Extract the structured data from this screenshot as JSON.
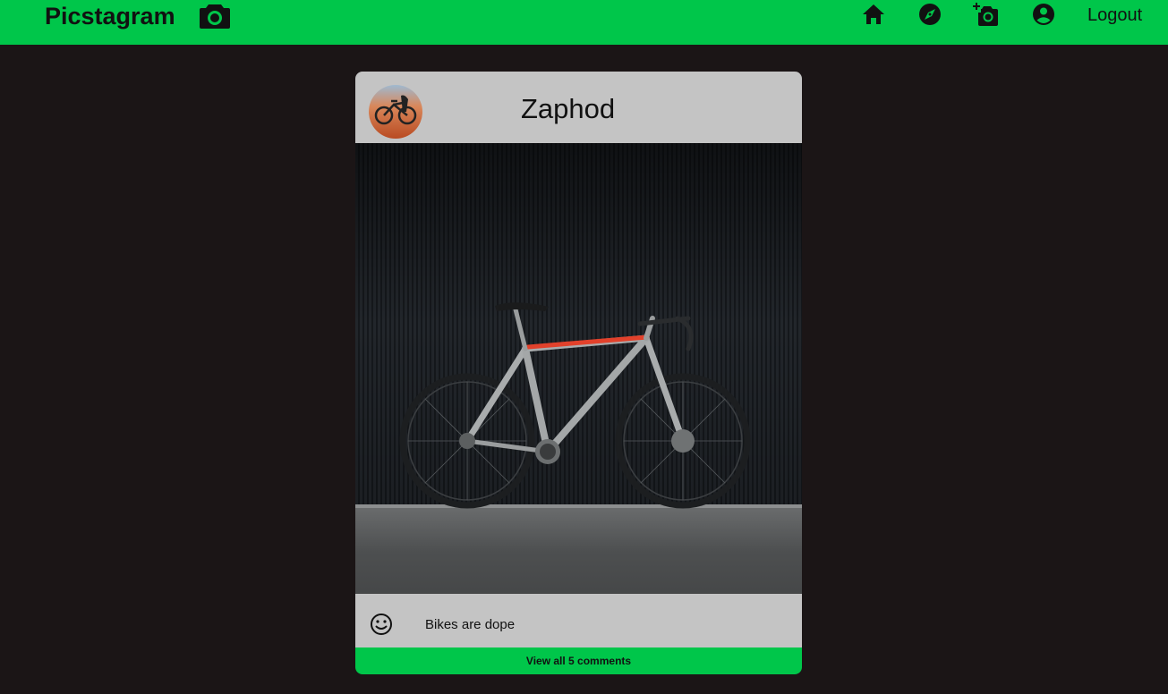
{
  "navbar": {
    "brand": "Picstagram",
    "brand_icon": "camera-icon",
    "icons": [
      "home-icon",
      "explore-compass-icon",
      "add-photo-icon",
      "account-icon"
    ],
    "logout_label": "Logout",
    "accent_color": "#00c64a"
  },
  "post": {
    "username": "Zaphod",
    "caption": "Bikes are dope",
    "comments_link": "View all 5 comments",
    "panel_color": "#c4c4c4"
  },
  "page": {
    "background_color": "#1b1516"
  }
}
